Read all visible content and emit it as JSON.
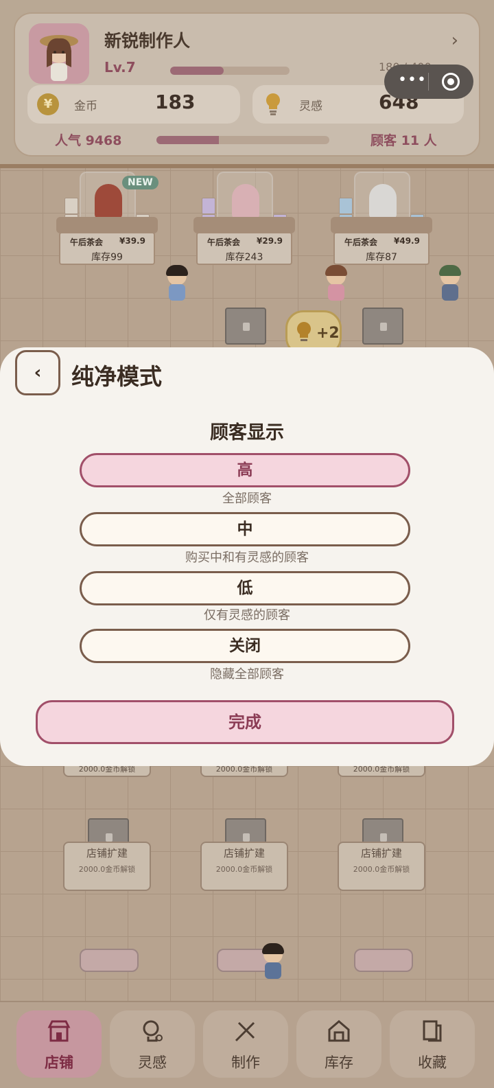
{
  "profile": {
    "name": "新锐制作人",
    "level": "Lv.7",
    "xp_text": "180 / 400",
    "xp_fraction": 0.45,
    "coins_label": "金币",
    "coins_value": "183",
    "inspiration_label": "灵感",
    "inspiration_value": "648",
    "popularity": "人气 9468",
    "popularity_fraction": 0.36,
    "customers": "顾客 11 人"
  },
  "shelves": [
    {
      "name": "午后茶会",
      "price": "¥39.9",
      "stock": "库存99",
      "tag": "NEW"
    },
    {
      "name": "午后茶会",
      "price": "¥29.9",
      "stock": "库存243",
      "tag": ""
    },
    {
      "name": "午后茶会",
      "price": "¥49.9",
      "stock": "库存87",
      "tag": ""
    }
  ],
  "idea_bubble": "+2",
  "expansions": [
    {
      "label": "店铺扩建",
      "cost": "2000.0金币解锁"
    },
    {
      "label": "店铺扩建",
      "cost": "2000.0金币解锁"
    },
    {
      "label": "店铺扩建",
      "cost": "2000.0金币解锁"
    }
  ],
  "hidden_costs": [
    "2000.0金币解锁",
    "2000.0金币解锁",
    "2000.0金币解锁"
  ],
  "dialog": {
    "title": "纯净模式",
    "back_icon": "‹",
    "section_title": "顾客显示",
    "options": [
      {
        "label": "高",
        "desc": "全部顾客",
        "selected": true
      },
      {
        "label": "中",
        "desc": "购买中和有灵感的顾客",
        "selected": false
      },
      {
        "label": "低",
        "desc": "仅有灵感的顾客",
        "selected": false
      },
      {
        "label": "关闭",
        "desc": "隐藏全部顾客",
        "selected": false
      }
    ],
    "done_label": "完成"
  },
  "nav": [
    {
      "label": "店铺",
      "icon": "shop-icon",
      "active": true
    },
    {
      "label": "灵感",
      "icon": "inspiration-icon",
      "active": false
    },
    {
      "label": "制作",
      "icon": "craft-icon",
      "active": false
    },
    {
      "label": "库存",
      "icon": "warehouse-icon",
      "active": false
    },
    {
      "label": "收藏",
      "icon": "collection-icon",
      "active": false
    }
  ],
  "colors": {
    "accent": "#a14f69",
    "dialog_bg": "#f6f3ee",
    "selected_bg": "#f5d6de"
  }
}
